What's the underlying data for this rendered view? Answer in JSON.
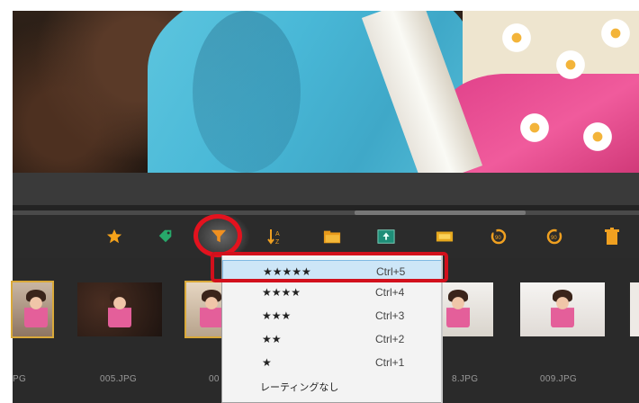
{
  "toolbar": {
    "icons": [
      "star-icon",
      "tag-icon",
      "filter-icon",
      "sort-icon",
      "folder-icon",
      "export-icon",
      "slideshow-icon",
      "rotate-left-icon",
      "rotate-right-icon",
      "trash-icon"
    ]
  },
  "thumbnails": [
    {
      "label": "PG"
    },
    {
      "label": "005.JPG"
    },
    {
      "label": "00"
    },
    {
      "label": "8.JPG"
    },
    {
      "label": "009.JPG"
    }
  ],
  "rating_menu": {
    "items": [
      {
        "stars": "★★★★★",
        "shortcut": "Ctrl+5",
        "highlighted": true
      },
      {
        "stars": "★★★★",
        "shortcut": "Ctrl+4"
      },
      {
        "stars": "★★★",
        "shortcut": "Ctrl+3"
      },
      {
        "stars": "★★",
        "shortcut": "Ctrl+2"
      },
      {
        "stars": "★",
        "shortcut": "Ctrl+1"
      },
      {
        "stars": "レーティングなし",
        "shortcut": ""
      }
    ]
  },
  "colors": {
    "accent_orange": "#f0a020",
    "annotation_red": "#e3121e",
    "menu_highlight": "#cde6f7",
    "panel_bg": "#2a2a2a"
  }
}
